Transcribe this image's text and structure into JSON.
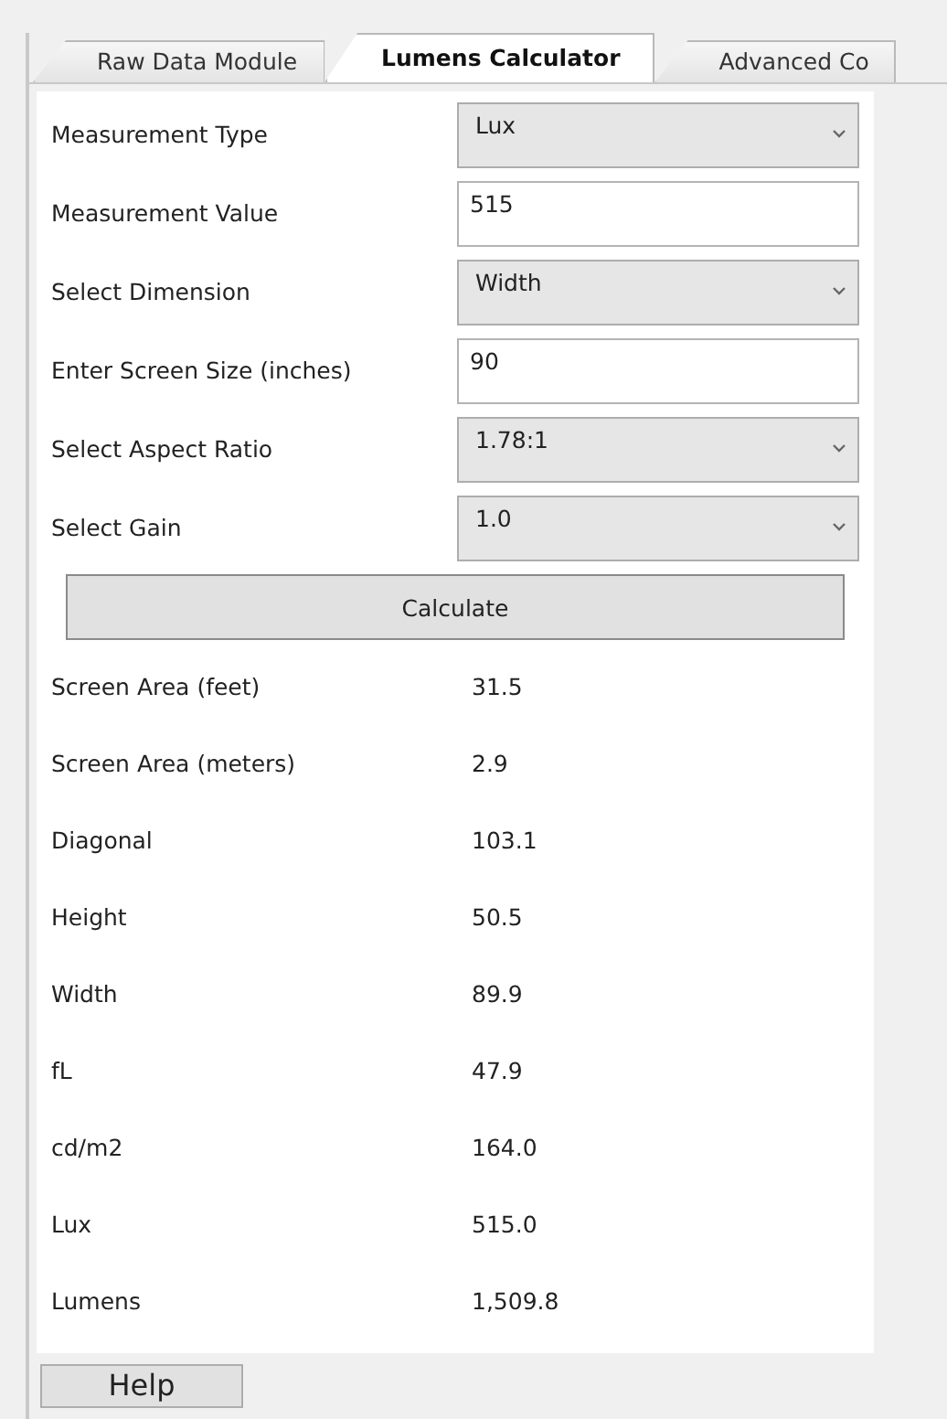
{
  "tabs": [
    {
      "label": "Raw Data Module",
      "selected": false
    },
    {
      "label": "Lumens Calculator",
      "selected": true
    },
    {
      "label": "Advanced Co",
      "selected": false
    }
  ],
  "form": [
    {
      "kind": "dropdown",
      "label": "Measurement Type",
      "value": "Lux"
    },
    {
      "kind": "input",
      "label": "Measurement Value",
      "value": "515"
    },
    {
      "kind": "dropdown",
      "label": "Select Dimension",
      "value": "Width"
    },
    {
      "kind": "input",
      "label": "Enter Screen Size (inches)",
      "value": "90"
    },
    {
      "kind": "dropdown",
      "label": "Select Aspect Ratio",
      "value": "1.78:1"
    },
    {
      "kind": "dropdown",
      "label": "Select Gain",
      "value": "1.0"
    }
  ],
  "calculate_button": "Calculate",
  "results": [
    {
      "label": "Screen Area (feet)",
      "value": "31.5"
    },
    {
      "label": "Screen Area (meters)",
      "value": "2.9"
    },
    {
      "label": "Diagonal",
      "value": "103.1"
    },
    {
      "label": "Height",
      "value": "50.5"
    },
    {
      "label": "Width",
      "value": "89.9"
    },
    {
      "label": "fL",
      "value": "47.9"
    },
    {
      "label": "cd/m2",
      "value": "164.0"
    },
    {
      "label": "Lux",
      "value": "515.0"
    },
    {
      "label": "Lumens",
      "value": "1,509.8"
    }
  ],
  "help_button": "Help"
}
